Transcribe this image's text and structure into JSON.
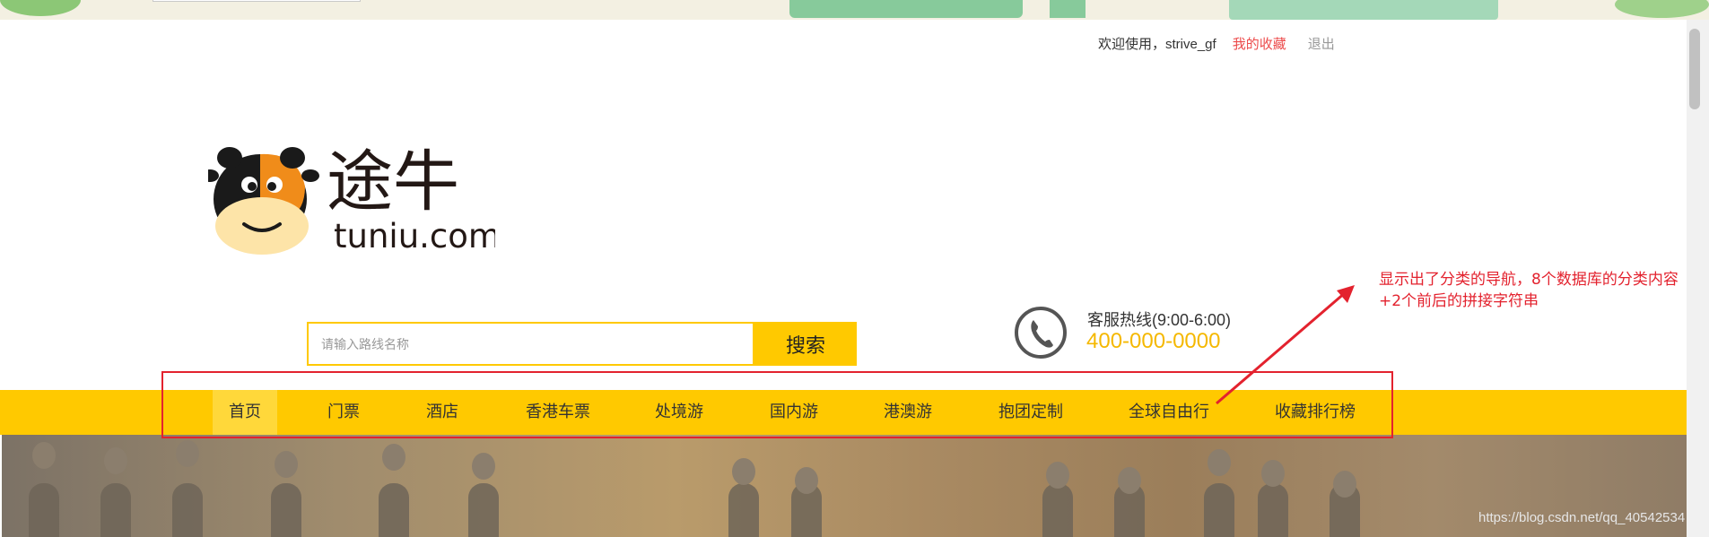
{
  "header": {
    "welcome": "欢迎使用，strive_gf",
    "favorites_link": "我的收藏",
    "logout_link": "退出"
  },
  "logo": {
    "brand_cn": "途牛",
    "brand_en": "tuniu.com"
  },
  "search": {
    "placeholder": "请输入路线名称",
    "button_label": "搜索"
  },
  "hotline": {
    "title": "客服热线(9:00-6:00)",
    "number": "400-000-0000",
    "icon": "phone-icon"
  },
  "nav": {
    "items": [
      {
        "label": "首页",
        "active": true
      },
      {
        "label": "门票"
      },
      {
        "label": "酒店"
      },
      {
        "label": "香港车票"
      },
      {
        "label": "处境游"
      },
      {
        "label": "国内游"
      },
      {
        "label": "港澳游"
      },
      {
        "label": "抱团定制"
      },
      {
        "label": "全球自由行"
      },
      {
        "label": "收藏排行榜"
      }
    ]
  },
  "annotation": {
    "line1": "显示出了分类的导航，8个数据库的分类内容",
    "line2": "+2个前后的拼接字符串"
  },
  "watermark": "https://blog.csdn.net/qq_40542534",
  "colors": {
    "accent": "#ffc900",
    "hotline_number": "#f5b800",
    "favorites": "#ec4b4b",
    "annotation": "#e3222e"
  }
}
